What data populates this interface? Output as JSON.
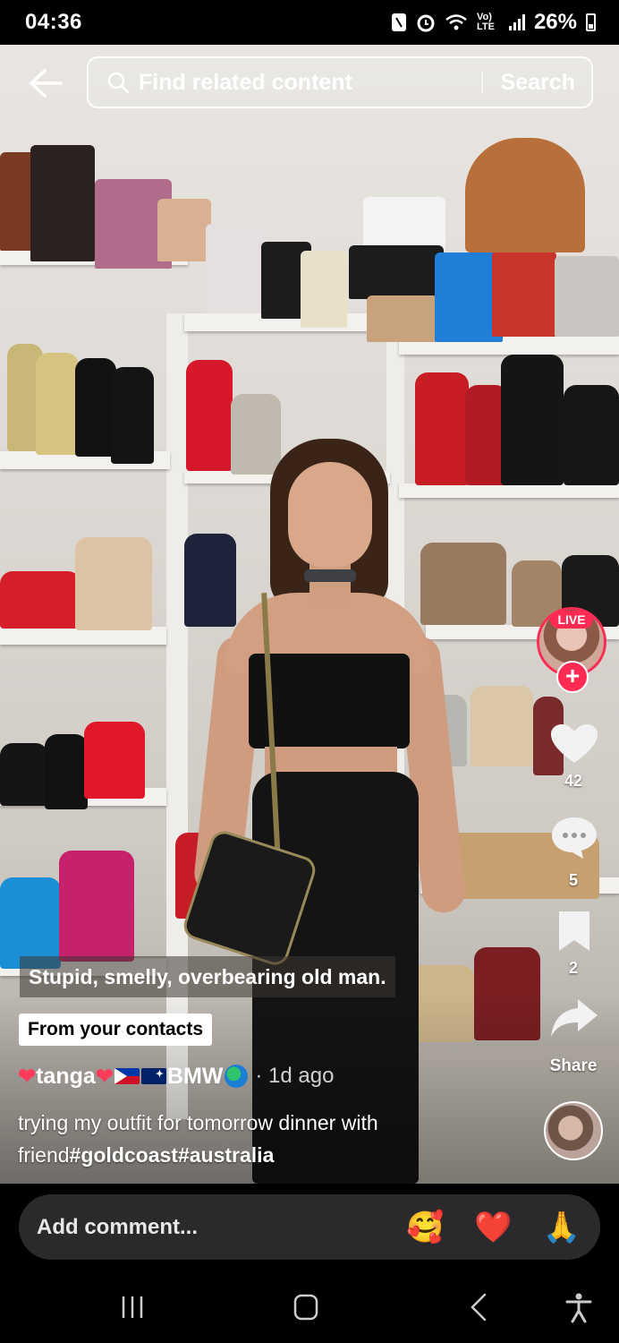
{
  "status_bar": {
    "time": "04:36",
    "network_label": "Vo) LTE",
    "battery_percent": "26%",
    "icons": [
      "nfc-icon",
      "alarm-icon",
      "wifi-icon",
      "signal-icon",
      "battery-icon"
    ]
  },
  "search": {
    "placeholder": "Find related content",
    "button_label": "Search"
  },
  "live_badge": "LIVE",
  "actions": {
    "likes": "42",
    "comments": "5",
    "saves": "2",
    "share_label": "Share"
  },
  "video": {
    "caption_overlay": "Stupid, smelly, overbearing old man.",
    "contacts_badge": "From your contacts",
    "author_name": "tanga",
    "author_suffix": "BMW",
    "time_ago": "· 1d ago",
    "description": "trying my outfit for tomorrow dinner with friend",
    "hashtags": [
      "#goldcoast",
      "#australia"
    ]
  },
  "comment_bar": {
    "placeholder": "Add comment...",
    "emojis": [
      "🥰",
      "❤️",
      "🙏"
    ]
  },
  "colors": {
    "accent": "#fe2c55",
    "comment_bar_bg": "#2a2a2c"
  }
}
